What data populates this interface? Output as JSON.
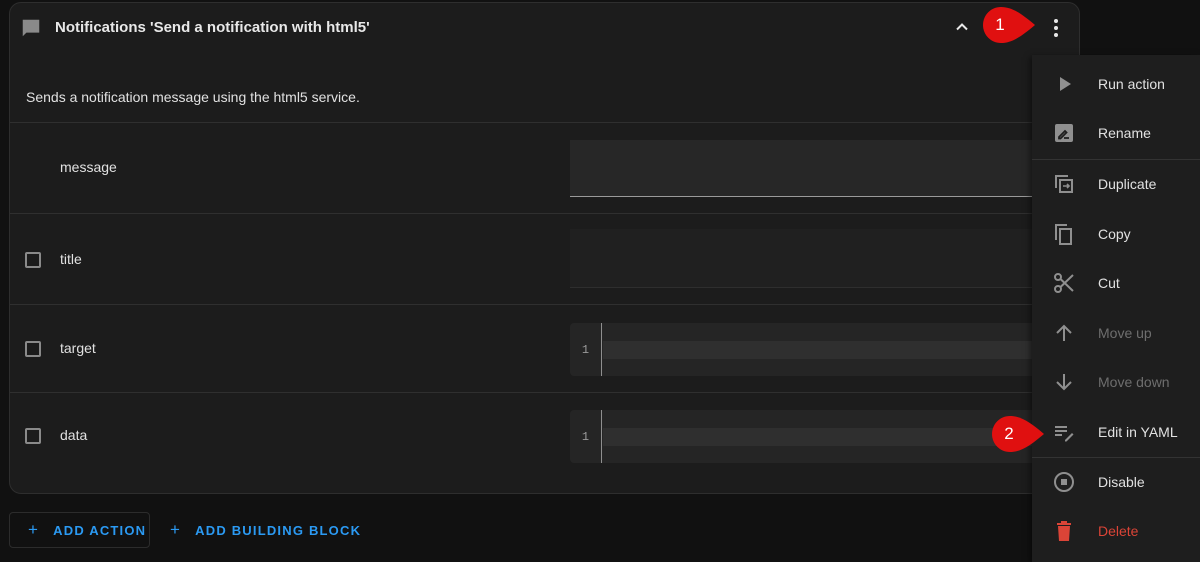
{
  "card": {
    "title": "Notifications 'Send a notification with html5'",
    "description": "Sends a notification message using the html5 service.",
    "fields": [
      {
        "name": "message",
        "has_checkbox": false,
        "checked": false,
        "type": "text",
        "value": ""
      },
      {
        "name": "title",
        "has_checkbox": true,
        "checked": false,
        "type": "text",
        "value": ""
      },
      {
        "name": "target",
        "has_checkbox": true,
        "checked": false,
        "type": "yaml",
        "line_number": "1",
        "value": ""
      },
      {
        "name": "data",
        "has_checkbox": true,
        "checked": false,
        "type": "yaml",
        "line_number": "1",
        "value": ""
      }
    ]
  },
  "buttons": {
    "add_action": "ADD ACTION",
    "add_building_block": "ADD BUILDING BLOCK",
    "plus": "+"
  },
  "menu": {
    "items": [
      {
        "label": "Run action",
        "icon": "play-icon",
        "disabled": false
      },
      {
        "label": "Rename",
        "icon": "rename-icon",
        "disabled": false
      },
      {
        "label": "Duplicate",
        "icon": "duplicate-icon",
        "disabled": false
      },
      {
        "label": "Copy",
        "icon": "copy-icon",
        "disabled": false
      },
      {
        "label": "Cut",
        "icon": "scissors-icon",
        "disabled": false
      },
      {
        "label": "Move up",
        "icon": "arrow-up-icon",
        "disabled": true
      },
      {
        "label": "Move down",
        "icon": "arrow-down-icon",
        "disabled": true
      },
      {
        "label": "Edit in YAML",
        "icon": "edit-yaml-icon",
        "disabled": false
      },
      {
        "label": "Disable",
        "icon": "disable-icon",
        "disabled": false
      },
      {
        "label": "Delete",
        "icon": "trash-icon",
        "disabled": false,
        "danger": true
      }
    ]
  },
  "annotations": [
    {
      "number": "1",
      "color": "#e01010"
    },
    {
      "number": "2",
      "color": "#e01010"
    }
  ],
  "colors": {
    "accent": "#2b9af3",
    "danger": "#db4437",
    "background": "#111111",
    "card": "#1c1c1c"
  }
}
